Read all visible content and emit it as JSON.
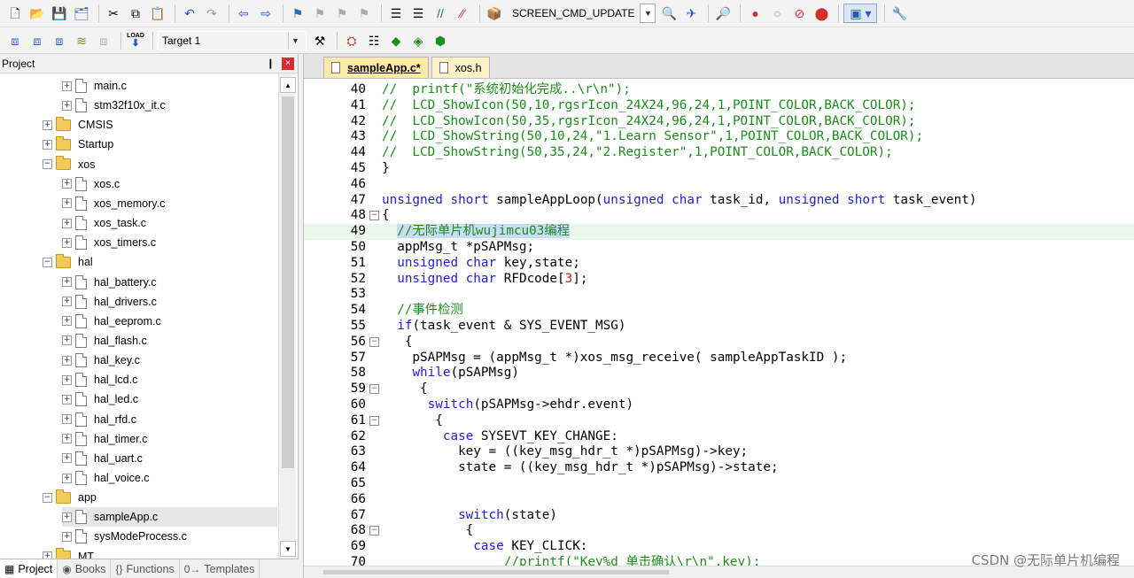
{
  "toolbar1": {
    "command_combo": "SCREEN_CMD_UPDATE",
    "icons": [
      "new-file-icon",
      "open-file-icon",
      "save-icon",
      "save-all-icon",
      "cut-icon",
      "copy-icon",
      "paste-icon",
      "undo-icon",
      "redo-icon",
      "nav-back-icon",
      "nav-forward-icon",
      "bookmark-icon",
      "bookmark-prev-icon",
      "bookmark-next-icon",
      "bookmark-clear-icon",
      "indent-icon",
      "unindent-icon",
      "comment-icon",
      "uncomment-icon",
      "find-in-files-icon",
      "find-replace-icon",
      "debug-icon",
      "breakpoint-icon",
      "breakpoint-disable-icon",
      "breakpoint-clear-icon",
      "breakpoint-kill-icon",
      "window-layout-icon",
      "configure-icon"
    ]
  },
  "toolbar2": {
    "target_combo": "Target 1",
    "load_label": "LOAD"
  },
  "project_panel": {
    "title": "Project",
    "pin": "❙",
    "close": "×",
    "tree": [
      {
        "label": "main.c",
        "kind": "file",
        "depth": 2
      },
      {
        "label": "stm32f10x_it.c",
        "kind": "file",
        "depth": 2
      },
      {
        "label": "CMSIS",
        "kind": "folder",
        "depth": 1,
        "expanded": false
      },
      {
        "label": "Startup",
        "kind": "folder",
        "depth": 1,
        "expanded": false
      },
      {
        "label": "xos",
        "kind": "folder",
        "depth": 1,
        "expanded": true
      },
      {
        "label": "xos.c",
        "kind": "file",
        "depth": 2
      },
      {
        "label": "xos_memory.c",
        "kind": "file",
        "depth": 2
      },
      {
        "label": "xos_task.c",
        "kind": "file",
        "depth": 2
      },
      {
        "label": "xos_timers.c",
        "kind": "file",
        "depth": 2
      },
      {
        "label": "hal",
        "kind": "folder",
        "depth": 1,
        "expanded": true
      },
      {
        "label": "hal_battery.c",
        "kind": "file",
        "depth": 2
      },
      {
        "label": "hal_drivers.c",
        "kind": "file",
        "depth": 2
      },
      {
        "label": "hal_eeprom.c",
        "kind": "file",
        "depth": 2
      },
      {
        "label": "hal_flash.c",
        "kind": "file",
        "depth": 2
      },
      {
        "label": "hal_key.c",
        "kind": "file",
        "depth": 2
      },
      {
        "label": "hal_lcd.c",
        "kind": "file",
        "depth": 2
      },
      {
        "label": "hal_led.c",
        "kind": "file",
        "depth": 2
      },
      {
        "label": "hal_rfd.c",
        "kind": "file",
        "depth": 2
      },
      {
        "label": "hal_timer.c",
        "kind": "file",
        "depth": 2
      },
      {
        "label": "hal_uart.c",
        "kind": "file",
        "depth": 2
      },
      {
        "label": "hal_voice.c",
        "kind": "file",
        "depth": 2
      },
      {
        "label": "app",
        "kind": "folder",
        "depth": 1,
        "expanded": true
      },
      {
        "label": "sampleApp.c",
        "kind": "file",
        "depth": 2,
        "selected": true
      },
      {
        "label": "sysModeProcess.c",
        "kind": "file",
        "depth": 2
      },
      {
        "label": "MT",
        "kind": "folder",
        "depth": 1,
        "expanded": false
      }
    ],
    "bottom_tabs": [
      {
        "label": "Project",
        "icon": "project-icon",
        "glyph": "▦",
        "active": true
      },
      {
        "label": "Books",
        "icon": "books-icon",
        "glyph": "◉",
        "active": false
      },
      {
        "label": "Functions",
        "icon": "functions-icon",
        "glyph": "{}",
        "active": false
      },
      {
        "label": "Templates",
        "icon": "templates-icon",
        "glyph": "0→",
        "active": false
      }
    ]
  },
  "editor": {
    "tabs": [
      {
        "label": "sampleApp.c*",
        "active": true
      },
      {
        "label": "xos.h",
        "active": false
      }
    ],
    "lines": [
      {
        "n": "40",
        "fold": "",
        "hl": false,
        "tokens": [
          [
            "cm",
            "//  printf(\"系统初始化完成..\\r\\n\");"
          ]
        ]
      },
      {
        "n": "41",
        "fold": "",
        "hl": false,
        "tokens": [
          [
            "cm",
            "//  LCD_ShowIcon(50,10,rgsrIcon_24X24,96,24,1,POINT_COLOR,BACK_COLOR);"
          ]
        ]
      },
      {
        "n": "42",
        "fold": "",
        "hl": false,
        "tokens": [
          [
            "cm",
            "//  LCD_ShowIcon(50,35,rgsrIcon_24X24,96,24,1,POINT_COLOR,BACK_COLOR);"
          ]
        ]
      },
      {
        "n": "43",
        "fold": "",
        "hl": false,
        "tokens": [
          [
            "cm",
            "//  LCD_ShowString(50,10,24,\"1.Learn Sensor\",1,POINT_COLOR,BACK_COLOR);"
          ]
        ]
      },
      {
        "n": "44",
        "fold": "",
        "hl": false,
        "tokens": [
          [
            "cm",
            "//  LCD_ShowString(50,35,24,\"2.Register\",1,POINT_COLOR,BACK_COLOR);"
          ]
        ]
      },
      {
        "n": "45",
        "fold": "",
        "hl": false,
        "tokens": [
          [
            "",
            "}"
          ]
        ]
      },
      {
        "n": "46",
        "fold": "",
        "hl": false,
        "tokens": []
      },
      {
        "n": "47",
        "fold": "",
        "hl": false,
        "tokens": [
          [
            "kw",
            "unsigned"
          ],
          [
            "",
            " "
          ],
          [
            "kw",
            "short"
          ],
          [
            "",
            " sampleAppLoop("
          ],
          [
            "kw",
            "unsigned"
          ],
          [
            "",
            " "
          ],
          [
            "kw",
            "char"
          ],
          [
            "",
            " task_id, "
          ],
          [
            "kw",
            "unsigned"
          ],
          [
            "",
            " "
          ],
          [
            "kw",
            "short"
          ],
          [
            "",
            " task_event)"
          ]
        ]
      },
      {
        "n": "48",
        "fold": "−",
        "hl": false,
        "tokens": [
          [
            "",
            "{"
          ]
        ]
      },
      {
        "n": "49",
        "fold": "",
        "hl": true,
        "tokens": [
          [
            "",
            "  "
          ],
          [
            "cm sel-text",
            "//无际单片机wujimcu03编程"
          ]
        ]
      },
      {
        "n": "50",
        "fold": "",
        "hl": false,
        "tokens": [
          [
            "",
            "  appMsg_t *pSAPMsg;"
          ]
        ]
      },
      {
        "n": "51",
        "fold": "",
        "hl": false,
        "tokens": [
          [
            "",
            "  "
          ],
          [
            "kw",
            "unsigned"
          ],
          [
            "",
            " "
          ],
          [
            "kw",
            "char"
          ],
          [
            "",
            " key,state;"
          ]
        ]
      },
      {
        "n": "52",
        "fold": "",
        "hl": false,
        "tokens": [
          [
            "",
            "  "
          ],
          [
            "kw",
            "unsigned"
          ],
          [
            "",
            " "
          ],
          [
            "kw",
            "char"
          ],
          [
            "",
            " RFDcode["
          ],
          [
            "num",
            "3"
          ],
          [
            "",
            "];"
          ]
        ]
      },
      {
        "n": "53",
        "fold": "",
        "hl": false,
        "tokens": []
      },
      {
        "n": "54",
        "fold": "",
        "hl": false,
        "tokens": [
          [
            "",
            "  "
          ],
          [
            "cm",
            "//事件检测"
          ]
        ]
      },
      {
        "n": "55",
        "fold": "",
        "hl": false,
        "tokens": [
          [
            "",
            "  "
          ],
          [
            "kw",
            "if"
          ],
          [
            "",
            "(task_event & SYS_EVENT_MSG)"
          ]
        ]
      },
      {
        "n": "56",
        "fold": "−",
        "hl": false,
        "tokens": [
          [
            "",
            "   {"
          ]
        ]
      },
      {
        "n": "57",
        "fold": "",
        "hl": false,
        "tokens": [
          [
            "",
            "    pSAPMsg = (appMsg_t *)xos_msg_receive( sampleAppTaskID );"
          ]
        ]
      },
      {
        "n": "58",
        "fold": "",
        "hl": false,
        "tokens": [
          [
            "",
            "    "
          ],
          [
            "kw",
            "while"
          ],
          [
            "",
            "(pSAPMsg)"
          ]
        ]
      },
      {
        "n": "59",
        "fold": "−",
        "hl": false,
        "tokens": [
          [
            "",
            "     {"
          ]
        ]
      },
      {
        "n": "60",
        "fold": "",
        "hl": false,
        "tokens": [
          [
            "",
            "      "
          ],
          [
            "kw",
            "switch"
          ],
          [
            "",
            "(pSAPMsg->ehdr.event)"
          ]
        ]
      },
      {
        "n": "61",
        "fold": "−",
        "hl": false,
        "tokens": [
          [
            "",
            "       {"
          ]
        ]
      },
      {
        "n": "62",
        "fold": "",
        "hl": false,
        "tokens": [
          [
            "",
            "        "
          ],
          [
            "kw",
            "case"
          ],
          [
            "",
            " SYSEVT_KEY_CHANGE:"
          ]
        ]
      },
      {
        "n": "63",
        "fold": "",
        "hl": false,
        "tokens": [
          [
            "",
            "          key = ((key_msg_hdr_t *)pSAPMsg)->key;"
          ]
        ]
      },
      {
        "n": "64",
        "fold": "",
        "hl": false,
        "tokens": [
          [
            "",
            "          state = ((key_msg_hdr_t *)pSAPMsg)->state;"
          ]
        ]
      },
      {
        "n": "65",
        "fold": "",
        "hl": false,
        "tokens": []
      },
      {
        "n": "66",
        "fold": "",
        "hl": false,
        "tokens": []
      },
      {
        "n": "67",
        "fold": "",
        "hl": false,
        "tokens": [
          [
            "",
            "          "
          ],
          [
            "kw",
            "switch"
          ],
          [
            "",
            "(state)"
          ]
        ]
      },
      {
        "n": "68",
        "fold": "−",
        "hl": false,
        "tokens": [
          [
            "",
            "           {"
          ]
        ]
      },
      {
        "n": "69",
        "fold": "",
        "hl": false,
        "tokens": [
          [
            "",
            "            "
          ],
          [
            "kw",
            "case"
          ],
          [
            "",
            " KEY_CLICK:"
          ]
        ]
      },
      {
        "n": "70",
        "fold": "",
        "hl": false,
        "tokens": [
          [
            "",
            "                "
          ],
          [
            "cm",
            "//printf(\"Key%d 单击确认\\r\\n\",key);"
          ]
        ]
      }
    ]
  },
  "watermark": "CSDN @无际单片机编程"
}
